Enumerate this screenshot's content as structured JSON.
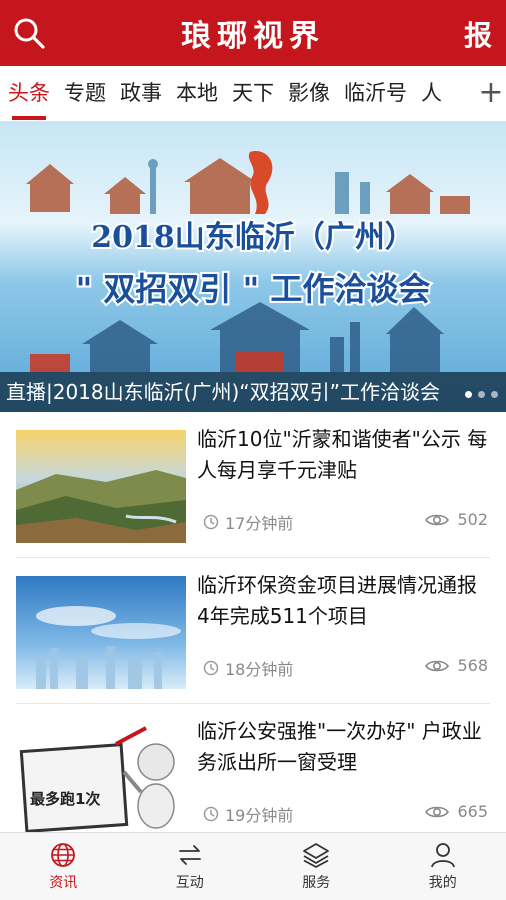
{
  "header": {
    "title": "琅琊视界",
    "report_label": "报",
    "search_icon": "search-icon"
  },
  "tabs": {
    "items": [
      "头条",
      "专题",
      "政事",
      "本地",
      "天下",
      "影像",
      "临沂号",
      "人"
    ],
    "active_index": 0,
    "add_label": "+"
  },
  "banner": {
    "line1": "2018山东临沂（广州）",
    "line2": "\" 双招双引 \" 工作洽谈会",
    "caption": "直播|2018山东临沂(广州)“双招双引”工作洽谈会",
    "dot_count": 3
  },
  "news": [
    {
      "title": "临沂10位\"沂蒙和谐使者\"公示 每人每月享千元津贴",
      "time": "17分钟前",
      "views": "502"
    },
    {
      "title": "临沂环保资金项目进展情况通报 4年完成511个项目",
      "time": "18分钟前",
      "views": "568"
    },
    {
      "title": "临沂公安强推\"一次办好\" 户政业务派出所一窗受理",
      "time": "19分钟前",
      "views": "665",
      "thumb_text": "最多跑1次"
    }
  ],
  "bottom_nav": {
    "items": [
      {
        "label": "资讯",
        "icon": "globe-icon"
      },
      {
        "label": "互动",
        "icon": "swap-arrows-icon"
      },
      {
        "label": "服务",
        "icon": "layers-icon"
      },
      {
        "label": "我的",
        "icon": "user-icon"
      }
    ],
    "active_index": 0
  },
  "colors": {
    "brand": "#c4161c",
    "muted": "#8a8a8a"
  }
}
